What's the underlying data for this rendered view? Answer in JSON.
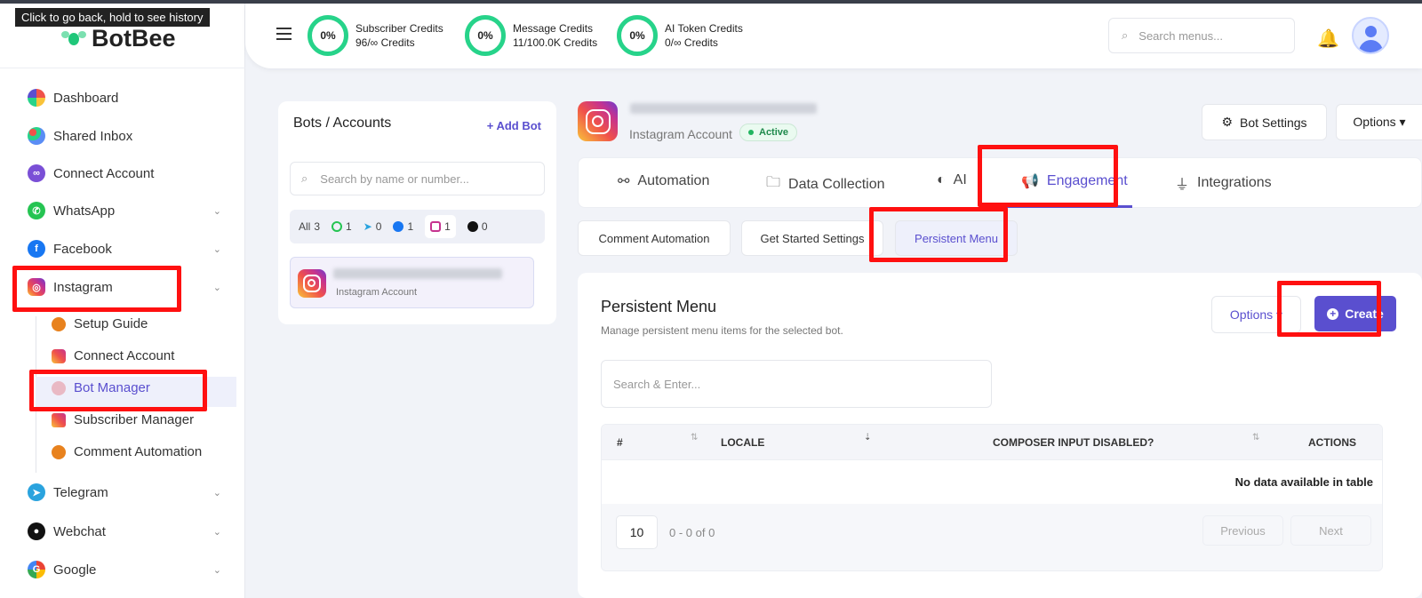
{
  "browser": {
    "tooltip": "Click to go back, hold to see history"
  },
  "brand": {
    "name": "BotBee"
  },
  "sidebar": {
    "items": [
      {
        "label": "Dashboard",
        "icon": "dashboard-icon"
      },
      {
        "label": "Shared Inbox",
        "icon": "shared-inbox-icon"
      },
      {
        "label": "Connect Account",
        "icon": "connect-account-icon"
      },
      {
        "label": "WhatsApp",
        "icon": "whatsapp-icon"
      },
      {
        "label": "Facebook",
        "icon": "facebook-icon"
      },
      {
        "label": "Instagram",
        "icon": "instagram-icon"
      },
      {
        "label": "Telegram",
        "icon": "telegram-icon"
      },
      {
        "label": "Webchat",
        "icon": "webchat-icon"
      },
      {
        "label": "Google",
        "icon": "google-icon"
      }
    ],
    "instagram_sub": [
      {
        "label": "Setup Guide"
      },
      {
        "label": "Connect Account"
      },
      {
        "label": "Bot Manager"
      },
      {
        "label": "Subscriber Manager"
      },
      {
        "label": "Comment Automation"
      }
    ]
  },
  "header": {
    "credits": [
      {
        "percent": "0%",
        "title": "Subscriber Credits",
        "value": "96/∞ Credits"
      },
      {
        "percent": "0%",
        "title": "Message Credits",
        "value": "11/100.0K Credits"
      },
      {
        "percent": "0%",
        "title": "AI Token Credits",
        "value": "0/∞ Credits"
      }
    ],
    "search_placeholder": "Search menus..."
  },
  "bots_panel": {
    "title": "Bots / Accounts",
    "add_label": "+ Add Bot",
    "search_placeholder": "Search by name or number...",
    "filters": [
      {
        "label": "All",
        "count": "3"
      },
      {
        "platform": "whatsapp",
        "count": "1"
      },
      {
        "platform": "telegram",
        "count": "0"
      },
      {
        "platform": "facebook",
        "count": "1"
      },
      {
        "platform": "instagram",
        "count": "1"
      },
      {
        "platform": "webchat",
        "count": "0"
      }
    ],
    "entry": {
      "subtitle": "Instagram Account"
    }
  },
  "account": {
    "subtitle": "Instagram Account",
    "status": "Active",
    "bot_settings_label": "Bot Settings",
    "options_label": "Options ▾"
  },
  "tabs": [
    {
      "label": "Automation"
    },
    {
      "label": "Data Collection"
    },
    {
      "label": "AI"
    },
    {
      "label": "Engagement"
    },
    {
      "label": "Integrations"
    }
  ],
  "subtabs": [
    {
      "label": "Comment Automation"
    },
    {
      "label": "Get Started Settings"
    },
    {
      "label": "Persistent Menu"
    }
  ],
  "persistent_menu": {
    "title": "Persistent Menu",
    "description": "Manage persistent menu items for the selected bot.",
    "options_label": "Options ▾",
    "create_label": "Create",
    "search_placeholder": "Search & Enter...",
    "columns": [
      "#",
      "LOCALE",
      "COMPOSER INPUT DISABLED?",
      "ACTIONS"
    ],
    "empty_text": "No data available in table",
    "page_length": "10",
    "info": "0 - 0 of 0",
    "prev_label": "Previous",
    "next_label": "Next"
  },
  "colors": {
    "accent": "#5a4fcf",
    "highlight": "#ff1010",
    "credit_ring": "#27d38a"
  }
}
